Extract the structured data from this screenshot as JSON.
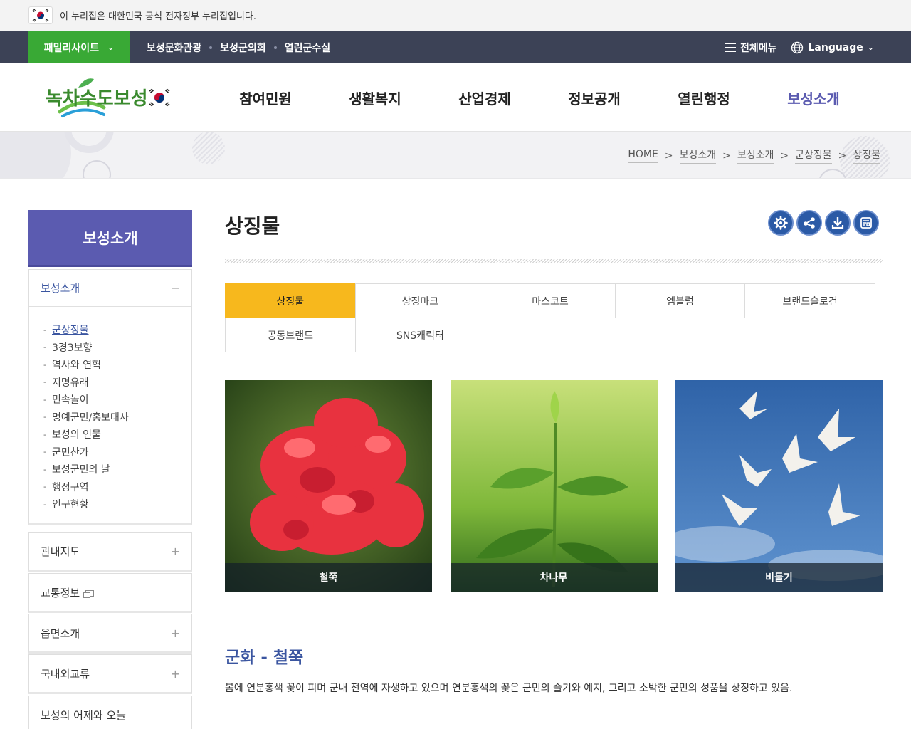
{
  "gov_notice": {
    "text": "이 누리집은 대한민국 공식 전자정부 누리집입니다."
  },
  "util_bar": {
    "family_site": "패밀리사이트",
    "links": [
      "보성문화관광",
      "보성군의회",
      "열린군수실"
    ],
    "all_menu": "전체메뉴",
    "language": "Language"
  },
  "header": {
    "logo_text": "녹차수도보성",
    "nav": [
      "참여민원",
      "생활복지",
      "산업경제",
      "정보공개",
      "열린행정",
      "보성소개"
    ],
    "active_nav": "보성소개"
  },
  "breadcrumb": [
    "HOME",
    "보성소개",
    "보성소개",
    "군상징물",
    "상징물"
  ],
  "lnb": {
    "title": "보성소개",
    "groups": [
      {
        "label": "보성소개",
        "expanded": true
      },
      {
        "label": "관내지도",
        "expanded": false
      },
      {
        "label": "교통정보",
        "external": true
      },
      {
        "label": "읍면소개",
        "expanded": false
      },
      {
        "label": "국내외교류",
        "expanded": false
      },
      {
        "label": "보성의 어제와 오늘"
      }
    ],
    "sub_items": [
      "군상징물",
      "3경3보향",
      "역사와 연혁",
      "지명유래",
      "민속놀이",
      "명예군민/홍보대사",
      "보성의 인물",
      "군민찬가",
      "보성군민의 날",
      "행정구역",
      "인구현황"
    ],
    "active_sub": "군상징물"
  },
  "content": {
    "page_title": "상징물",
    "tools": [
      "settings-icon",
      "share-icon",
      "download-icon",
      "print-icon"
    ],
    "tabs": [
      "상징물",
      "상징마크",
      "마스코트",
      "엠블럼",
      "브랜드슬로건",
      "공동브랜드",
      "SNS캐릭터"
    ],
    "active_tab": "상징물",
    "gallery": [
      {
        "caption": "철쭉"
      },
      {
        "caption": "차나무"
      },
      {
        "caption": "비둘기"
      }
    ],
    "section_title": "군화 - 철쭉",
    "section_desc": "봄에 연분홍색 꽃이 피며 군내 전역에 자생하고 있으며 연분홍색의 꽃은 군민의 슬기와 예지, 그리고 소박한 군민의 성품을 상징하고 있음."
  },
  "colors": {
    "util_bar": "#3c4256",
    "family_green": "#39a935",
    "accent_purple": "#5b5bb0",
    "tab_active": "#f7b81d",
    "title_blue": "#3a55a0",
    "tool_blue": "#2b5aa6"
  }
}
